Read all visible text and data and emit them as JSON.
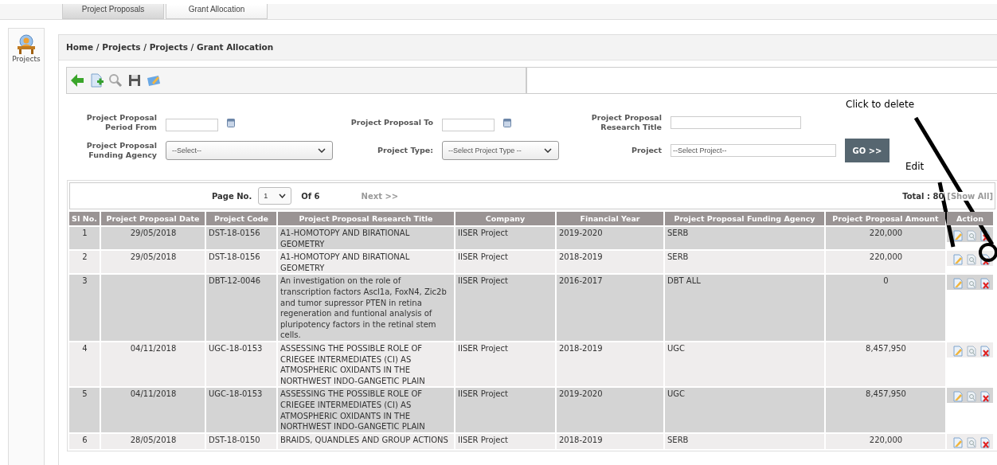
{
  "top_tabs": [
    {
      "label": "Project Proposals",
      "selected": false
    },
    {
      "label": "Grant Allocation",
      "selected": true
    }
  ],
  "sidebar": {
    "items": [
      {
        "label": "Projects"
      }
    ]
  },
  "breadcrumb": "Home / Projects / Projects / Grant Allocation",
  "filters": [
    {
      "kind": "date",
      "label": [
        "Project Proposal",
        "Period From"
      ]
    },
    {
      "kind": "date",
      "label": [
        "Project Proposal To"
      ]
    },
    {
      "kind": "text",
      "label": [
        "Project Proposal",
        "Research Title"
      ]
    },
    {
      "kind": "select",
      "label": [
        "Project Proposal",
        "Funding Agency"
      ],
      "value": "--Select--"
    },
    {
      "kind": "select",
      "label": [
        "Project Type:"
      ],
      "value": "--Select Project Type --"
    },
    {
      "kind": "text",
      "label": [
        "Project"
      ],
      "placeholder": "--Select Project--"
    }
  ],
  "go_button": "GO >>",
  "pager": {
    "page_label": "Page No.",
    "page": "1",
    "of": "Of 6",
    "next": {
      "label": "Next >>",
      "disabled": true
    },
    "total": "Total : 80",
    "show_all": "[Show All]"
  },
  "table": {
    "columns": [
      "SI No.",
      "Project Proposal Date",
      "Project Code",
      "Project Proposal Research Title",
      "Company",
      "Financial Year",
      "Project Proposal Funding Agency",
      "Project Proposal Amount",
      "Action"
    ],
    "rows": [
      {
        "cells": [
          "1",
          "29/05/2018",
          "DST-18-0156",
          "A1-HOMOTOPY AND BIRATIONAL GEOMETRY",
          "IISER Project",
          "2019-2020",
          "SERB",
          "220,000"
        ]
      },
      {
        "cells": [
          "2",
          "29/05/2018",
          "DST-18-0156",
          "A1-HOMOTOPY AND BIRATIONAL GEOMETRY",
          "IISER Project",
          "2018-2019",
          "SERB",
          "220,000"
        ]
      },
      {
        "cells": [
          "3",
          "",
          "DBT-12-0046",
          "An investigation on the role of transcription factors Ascl1a, FoxN4, Zic2b and tumor supressor PTEN in retina regeneration and funtional analysis of pluripotency factors in the retinal stem cells.",
          "IISER Project",
          "2016-2017",
          "DBT ALL",
          "0"
        ]
      },
      {
        "cells": [
          "4",
          "04/11/2018",
          "UGC-18-0153",
          "ASSESSING THE POSSIBLE ROLE OF CRIEGEE INTERMEDIATES (CI) AS ATMOSPHERIC OXIDANTS IN THE NORTHWEST INDO-GANGETIC PLAIN",
          "IISER Project",
          "2018-2019",
          "UGC",
          "8,457,950"
        ]
      },
      {
        "cells": [
          "5",
          "04/11/2018",
          "UGC-18-0153",
          "ASSESSING THE POSSIBLE ROLE OF CRIEGEE INTERMEDIATES (CI) AS ATMOSPHERIC OXIDANTS IN THE NORTHWEST INDO-GANGETIC PLAIN",
          "IISER Project",
          "2019-2020",
          "UGC",
          "8,457,950"
        ]
      },
      {
        "cells": [
          "6",
          "28/05/2018",
          "DST-18-0150",
          "BRAIDS, QUANDLES AND GROUP ACTIONS",
          "IISER Project",
          "2018-2019",
          "SERB",
          "220,000"
        ]
      }
    ]
  },
  "annotations": [
    {
      "kind": "delete",
      "text": "Click to delete"
    },
    {
      "kind": "edit",
      "text": "Edit"
    }
  ]
}
